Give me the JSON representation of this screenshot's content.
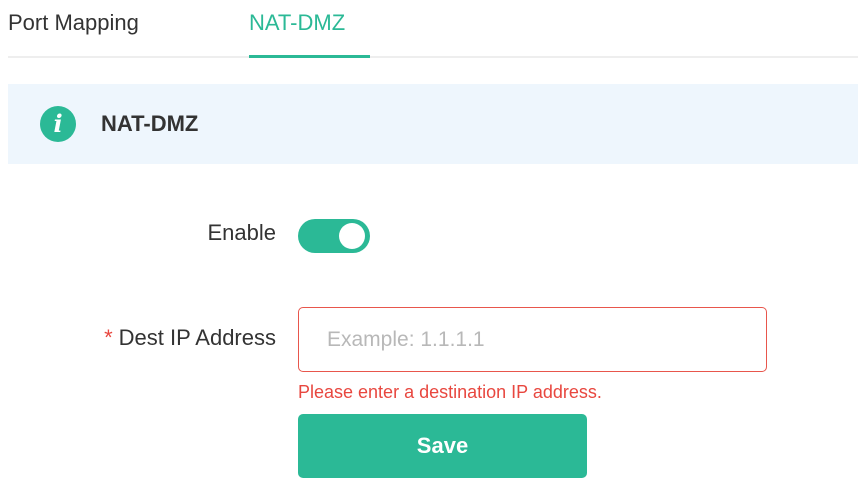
{
  "tabs": [
    {
      "label": "Port Mapping",
      "active": false
    },
    {
      "label": "NAT-DMZ",
      "active": true
    }
  ],
  "banner": {
    "icon": "info-icon",
    "icon_glyph": "i",
    "title": "NAT-DMZ"
  },
  "form": {
    "enable": {
      "label": "Enable",
      "checked": true
    },
    "dest_ip": {
      "required_mark": "*",
      "label": "Dest IP Address",
      "value": "",
      "placeholder": "Example: 1.1.1.1",
      "error": "Please enter a destination IP address."
    },
    "save_label": "Save"
  },
  "colors": {
    "accent": "#2bb996",
    "error": "#e8473f",
    "banner_bg": "#eef6fd"
  }
}
